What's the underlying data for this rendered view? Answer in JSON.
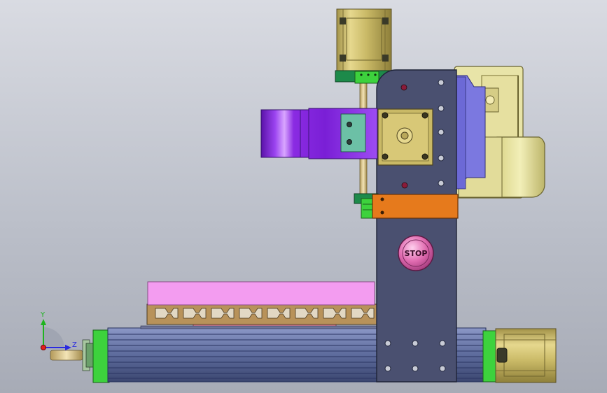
{
  "viewport": {
    "background_top": "#d9dbe2",
    "background_bottom": "#a7abb6"
  },
  "model": {
    "stop_button": {
      "label": "STOP",
      "color": "#e06bb0"
    },
    "colors": {
      "column_plate": "#4a5070",
      "stepper_motor": "#cdbd6a",
      "purple_bracket": "#8a2be2",
      "orange_block": "#e67a1c",
      "pink_table": "#f39cf0",
      "rail_body": "#5d6b9c",
      "end_cap_green": "#3dd23d",
      "blue_cover": "#7b78e0",
      "khaki_housing": "#d8d284",
      "teal_plate": "#6cc0a6",
      "extrusion_profile": "#b8925a"
    }
  },
  "triad": {
    "y_label": "Y",
    "z_label": "Z",
    "y_color": "#1fb41f",
    "z_color": "#2a2ae0",
    "x_color": "#e01f1f"
  }
}
